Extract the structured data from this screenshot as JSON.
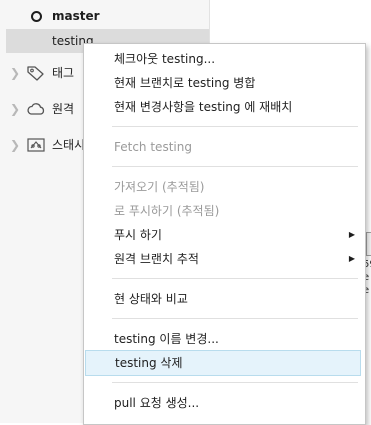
{
  "sidebar": {
    "current_branch": "master",
    "selected_branch": "testing",
    "sections": [
      {
        "label": "태그",
        "icon": "tag-icon"
      },
      {
        "label": "원격",
        "icon": "cloud-icon"
      },
      {
        "label": "스태시",
        "icon": "stash-icon"
      }
    ]
  },
  "context_menu": {
    "items": [
      {
        "label": "체크아웃 testing...",
        "enabled": true
      },
      {
        "label": "현재 브랜치로 testing 병합",
        "enabled": true
      },
      {
        "label": "현재 변경사항을 testing 에 재배치",
        "enabled": true
      },
      {
        "label": "Fetch testing",
        "enabled": false
      },
      {
        "label": "가져오기  (추적됨)",
        "enabled": false
      },
      {
        "label": "로 푸시하기 (추적됨)",
        "enabled": false
      },
      {
        "label": "푸시 하기",
        "enabled": true,
        "submenu": true
      },
      {
        "label": "원격 브랜치 추적",
        "enabled": true,
        "submenu": true
      },
      {
        "label": "현 상태와 비교",
        "enabled": true
      },
      {
        "label": "testing 이름 변경...",
        "enabled": true
      },
      {
        "label": "testing 삭제",
        "enabled": true,
        "highlighted": true
      },
      {
        "label": "pull 요청 생성...",
        "enabled": true
      }
    ]
  },
  "background_fragments": [
    "59",
    "e",
    "e"
  ],
  "colors": {
    "menu_highlight": "#e5f3fb",
    "menu_highlight_border": "#b8dced",
    "selected_row": "#dcdcdc",
    "disabled_text": "#9a9a9a"
  }
}
